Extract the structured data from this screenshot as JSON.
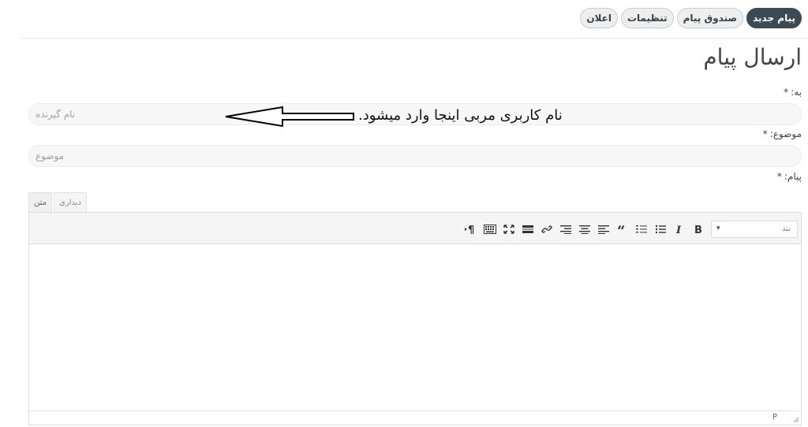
{
  "nav": {
    "tabs": [
      {
        "label": "پیام جدید",
        "active": true
      },
      {
        "label": "صندوق پیام",
        "active": false
      },
      {
        "label": "تنظیمات",
        "active": false
      },
      {
        "label": "اعلان",
        "active": false
      }
    ]
  },
  "page": {
    "title": "ارسال پیام"
  },
  "form": {
    "to": {
      "label": "به:",
      "required": "*",
      "placeholder": "نام گیرنده"
    },
    "subject": {
      "label": "موضوع:",
      "required": "*",
      "placeholder": "موضوع"
    },
    "message": {
      "label": "پیام:",
      "required": "*"
    }
  },
  "annotation": {
    "text": "نام کاربری مربی اینجا وارد میشود."
  },
  "editor": {
    "tabs": {
      "visual": "دیداری",
      "text": "متن"
    },
    "format_value": "بند",
    "format_caret": "▾",
    "toolbar_icons": [
      "bold-icon",
      "italic-icon",
      "bullet-list-icon",
      "numbered-list-icon",
      "blockquote-icon",
      "align-left-icon",
      "align-center-icon",
      "align-right-icon",
      "link-icon",
      "read-more-icon",
      "fullscreen-icon",
      "keyboard-icon",
      "rtl-paragraph-icon"
    ],
    "status_path": "P"
  }
}
